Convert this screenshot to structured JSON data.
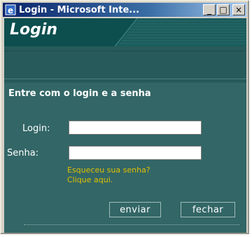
{
  "window": {
    "title": "Login - Microsoft Inte...",
    "controls": {
      "minimize": "_",
      "maximize": "□",
      "close": "×"
    }
  },
  "header": {
    "title": "Login"
  },
  "form": {
    "subtitle": "Entre com o login e a senha",
    "login_label": "Login:",
    "login_value": "",
    "password_label": "Senha:",
    "password_value": "",
    "forgot_line1": "Esqueceu sua senha?",
    "forgot_line2": "Clique aqui.",
    "submit_label": "enviar",
    "close_label": "fechar"
  },
  "colors": {
    "content_bg": "#336666",
    "header_bg": "#0d4e4e",
    "hint": "#e0c000"
  },
  "icons": {
    "app": "internet-explorer-icon"
  }
}
